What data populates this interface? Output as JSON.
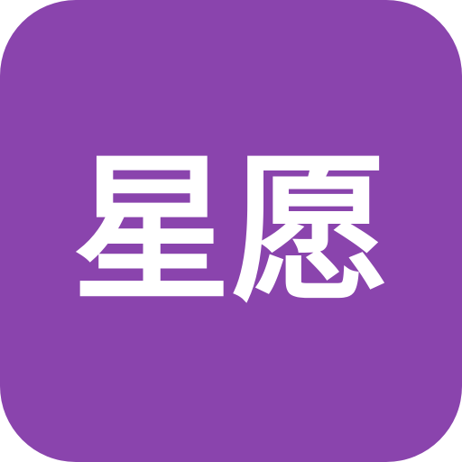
{
  "app_icon": {
    "label": "星愿",
    "background_color": "#8A44AD",
    "text_color": "#FFFFFF"
  }
}
